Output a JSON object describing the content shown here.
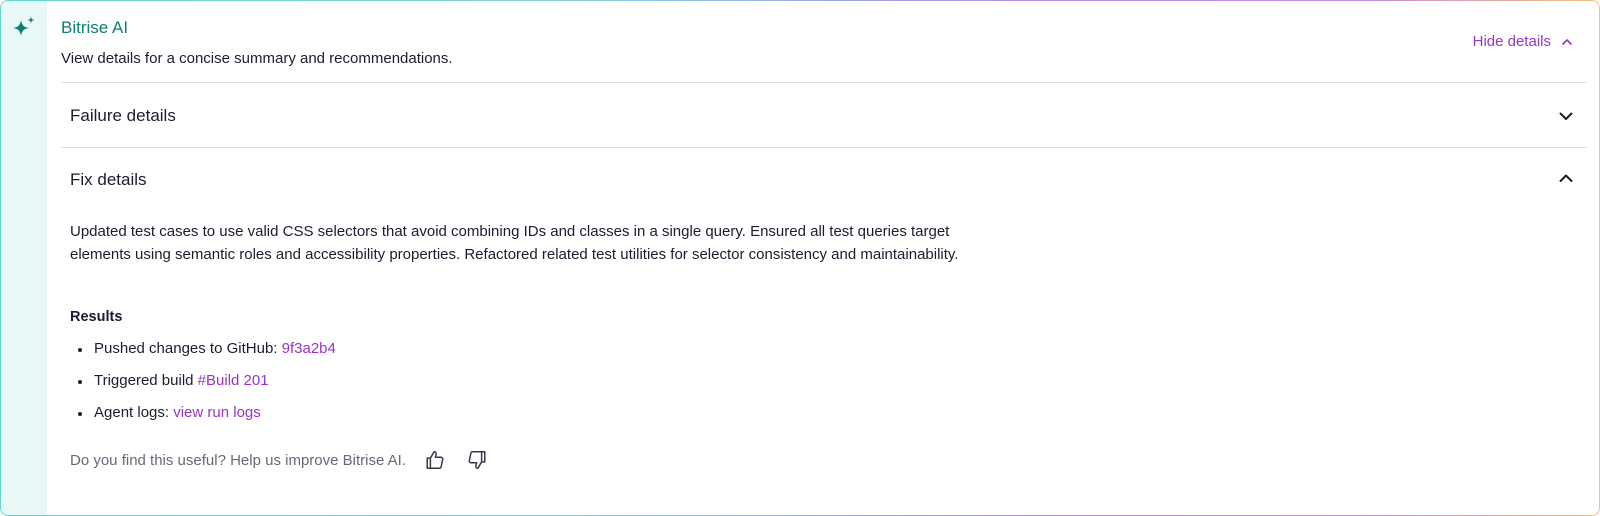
{
  "header": {
    "title": "Bitrise AI",
    "subtitle": "View details for a concise summary and recommendations.",
    "hide_details_label": "Hide details",
    "icon": "sparkle-icon"
  },
  "sections": {
    "failure": {
      "label": "Failure details",
      "state": "collapsed"
    },
    "fix": {
      "label": "Fix details",
      "state": "expanded",
      "description": "Updated test cases to use valid CSS selectors that avoid combining IDs and classes in a single query. Ensured all test queries target elements using semantic roles and accessibility properties. Refactored related test utilities for selector consistency and maintainability.",
      "results_title": "Results",
      "results": [
        {
          "text": "Pushed changes to GitHub: ",
          "link": "9f3a2b4"
        },
        {
          "text": "Triggered build ",
          "link": "#Build 201"
        },
        {
          "text": "Agent logs: ",
          "link": "view run logs"
        }
      ]
    }
  },
  "feedback": {
    "prompt": "Do you find this useful? Help us improve Bitrise AI.",
    "thumbs_up_icon": "thumbs-up-icon",
    "thumbs_down_icon": "thumbs-down-icon"
  },
  "colors": {
    "brand_teal": "#0e7f73",
    "link_purple": "#9a33c9",
    "rail_bg": "#e7f8f6",
    "text": "#201a2e",
    "muted": "#6b6677",
    "divider": "#dcdce1"
  }
}
